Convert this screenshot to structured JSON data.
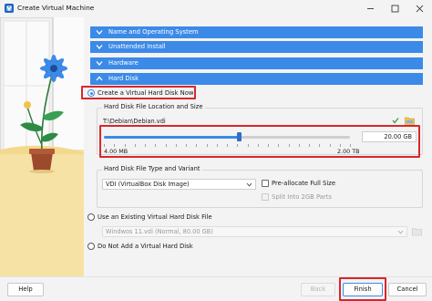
{
  "window": {
    "title": "Create Virtual Machine",
    "minimize_label": "—",
    "maximize_label": "□",
    "close_label": "✕"
  },
  "sections": {
    "name_os": "Name and Operating System",
    "unattended": "Unattended Install",
    "hardware": "Hardware",
    "hard_disk": "Hard Disk"
  },
  "hard_disk": {
    "create_option": "Create a Virtual Hard Disk Now",
    "location_group_label": "Hard Disk File Location and Size",
    "file_path": "T:\\Debian\\Debian.vdi",
    "size_value": "20.00 GB",
    "size_min_label": "4.00 MB",
    "size_max_label": "2.00 TB",
    "size_fraction": 0.55,
    "type_group_label": "Hard Disk File Type and Variant",
    "disk_type_selected": "VDI (VirtualBox Disk Image)",
    "preallocate_label": "Pre-allocate Full Size",
    "split_label": "Split Into 2GB Parts",
    "existing_option": "Use an Existing Virtual Hard Disk File",
    "existing_selected": "Windwos 11.vdi (Normal, 80.00 GB)",
    "none_option": "Do Not Add a Virtual Hard Disk"
  },
  "footer": {
    "help": "Help",
    "back": "Back",
    "finish": "Finish",
    "cancel": "Cancel"
  },
  "colors": {
    "accent": "#3c8ae8",
    "highlight": "#d9262b",
    "illustration_floor": "#f7e2a6"
  }
}
